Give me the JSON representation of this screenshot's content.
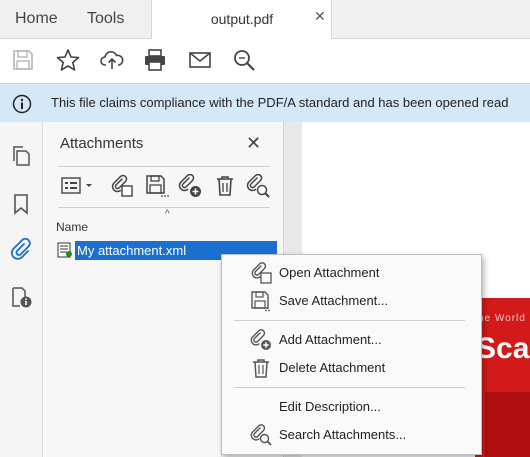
{
  "tabs": {
    "home": "Home",
    "tools": "Tools",
    "document": "output.pdf",
    "close_glyph": "✕"
  },
  "toolbar": {
    "icons": [
      "save-icon",
      "star-icon",
      "cloud-upload-icon",
      "print-icon",
      "mail-icon",
      "search-icon"
    ]
  },
  "banner": {
    "text": "This file claims compliance with the PDF/A standard and has been opened read",
    "icon": "info-icon",
    "color": "#d4e8f7"
  },
  "rail": {
    "icons": [
      "pages-icon",
      "bookmark-icon",
      "paperclip-icon",
      "document-info-icon"
    ]
  },
  "panel": {
    "title": "Attachments",
    "close_glyph": "✕",
    "tools": [
      "options-icon",
      "open-attachment-icon",
      "save-attachment-icon",
      "add-attachment-icon",
      "delete-icon",
      "search-attachment-icon"
    ],
    "column_header": "Name",
    "sort_glyph": "^",
    "attachment": "My attachment.xml",
    "selection_color": "#1a6fd1"
  },
  "cover": {
    "small_text": "he World",
    "big_text": "Scan"
  },
  "menu": {
    "items": [
      {
        "label": "Open Attachment",
        "icon": "open-attachment-icon"
      },
      {
        "label": "Save Attachment...",
        "icon": "save-attachment-icon"
      },
      {
        "label": "Add Attachment...",
        "icon": "add-attachment-icon"
      },
      {
        "label": "Delete Attachment",
        "icon": "trash-icon"
      },
      {
        "label": "Edit Description...",
        "icon": ""
      },
      {
        "label": "Search Attachments...",
        "icon": "search-attachment-icon"
      }
    ]
  }
}
